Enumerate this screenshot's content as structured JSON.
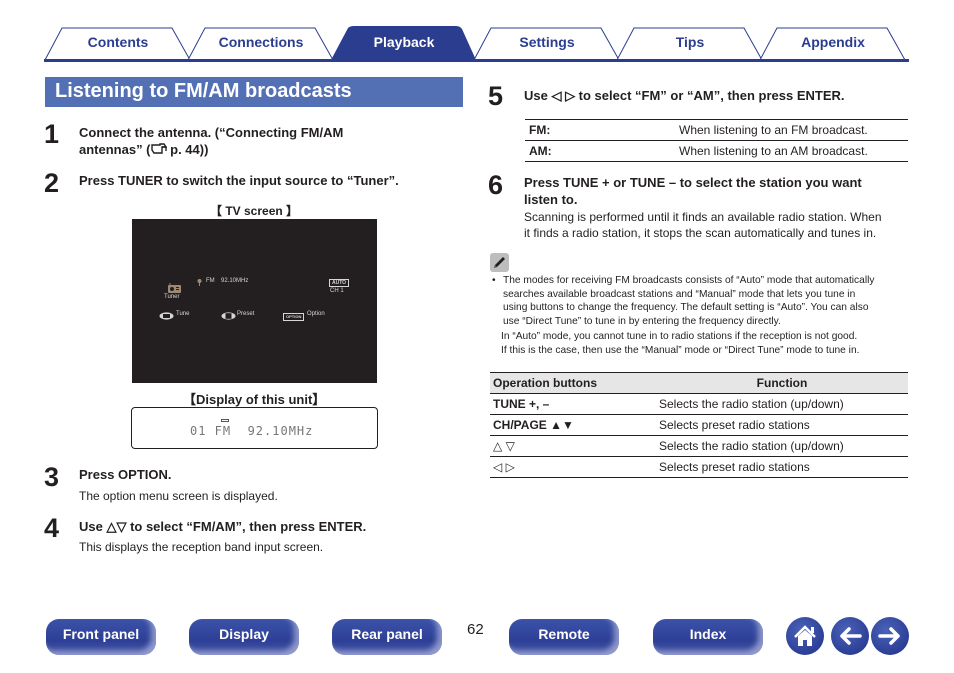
{
  "tabs": [
    {
      "label": "Contents",
      "active": false
    },
    {
      "label": "Connections",
      "active": false
    },
    {
      "label": "Playback",
      "active": true
    },
    {
      "label": "Settings",
      "active": false
    },
    {
      "label": "Tips",
      "active": false
    },
    {
      "label": "Appendix",
      "active": false
    }
  ],
  "section_title": "Listening to FM/AM broadcasts",
  "steps": [
    {
      "num": "1",
      "head": "Connect the antenna. (“Connecting FM/AM antennas” (☞ p. 44))",
      "head_line1": "Connect the antenna. (“Connecting FM/AM",
      "head_line2": "antennas” (",
      "head_ref_icon": "reference-hand-icon",
      "head_line2_tail": " p. 44))"
    },
    {
      "num": "2",
      "head": "Press TUNER to switch the input source to “Tuner”."
    },
    {
      "num": "3",
      "head": "Press OPTION.",
      "body": "The option menu screen is displayed."
    },
    {
      "num": "4",
      "head": "Use △▽ to select “FM/AM”, then press ENTER.",
      "body": "This displays the reception band input screen."
    },
    {
      "num": "5",
      "head": "Use ◁ ▷ to select “FM” or “AM”, then press ENTER."
    },
    {
      "num": "6",
      "head_line1": "Press TUNE + or TUNE – to select the station you want",
      "head_line2": "listen to.",
      "body_line1": "Scanning is performed until it finds an available radio station. When",
      "body_line2": "it finds a radio station, it stops the scan automatically and tunes in."
    }
  ],
  "tv_screen": {
    "caption": "【 TV screen 】",
    "source_label": "Tuner",
    "band": "FM",
    "frequency": "92.10MHz",
    "mode_badge": "AUTO",
    "channel": "CH 1",
    "hints": [
      {
        "icon": "cursor-left-right-icon",
        "label": "Tune"
      },
      {
        "icon": "cursor-up-down-icon",
        "label": "Preset"
      },
      {
        "icon": "option-button-icon",
        "badge": "OPTION",
        "label": "Option"
      }
    ]
  },
  "unit_display": {
    "caption": "【Display of this unit】",
    "text": "01 FM  92.10MHz"
  },
  "band_table": [
    {
      "key": "FM:",
      "value": "When listening to an FM broadcast."
    },
    {
      "key": "AM:",
      "value": "When listening to an AM broadcast."
    }
  ],
  "note": {
    "icon": "pencil-note-icon",
    "bullet_lines": [
      "The modes for receiving FM broadcasts consists of “Auto” mode that automatically",
      "searches available broadcast stations and “Manual” mode that lets you tune in",
      "using buttons to change the frequency. The default setting is “Auto”. You can also",
      "use “Direct Tune” to tune in by entering the frequency directly."
    ],
    "extra_lines": [
      "In “Auto” mode, you cannot tune in to radio stations if the reception is not good.",
      "If this is the case, then use the “Manual” mode or “Direct Tune” mode to tune in."
    ]
  },
  "ops_table": {
    "headers": [
      "Operation buttons",
      "Function"
    ],
    "rows": [
      {
        "button": "TUNE +, –",
        "function": "Selects the radio station (up/down)"
      },
      {
        "button": "CH/PAGE ▲▼",
        "function": "Selects preset radio stations"
      },
      {
        "button": "△ ▽",
        "function": "Selects the radio station (up/down)"
      },
      {
        "button": "◁ ▷",
        "function": "Selects preset radio stations"
      }
    ]
  },
  "bottom_nav": {
    "buttons": [
      "Front panel",
      "Display",
      "Rear panel",
      "Remote",
      "Index"
    ],
    "page_number": "62",
    "icons": [
      "home-icon",
      "back-arrow-icon",
      "forward-arrow-icon"
    ]
  },
  "colors": {
    "brand_blue": "#2b3d8f",
    "title_bar": "#5470b5",
    "table_header_bg": "#e6e6e6"
  }
}
